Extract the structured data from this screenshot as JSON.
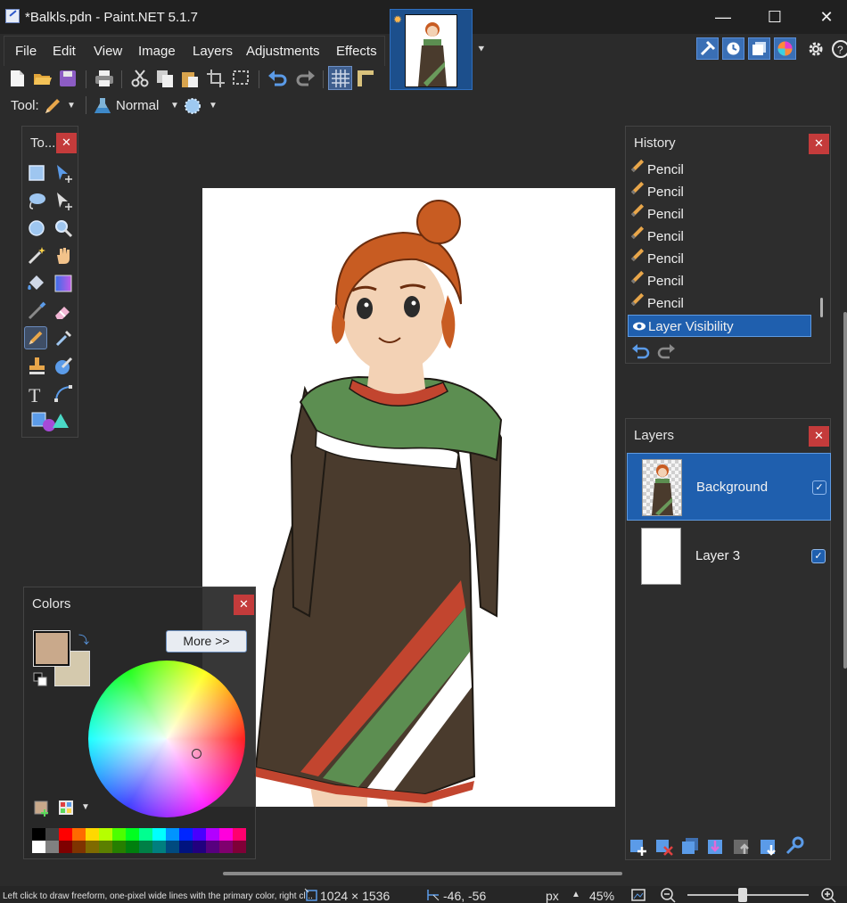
{
  "window": {
    "title": "*Balkls.pdn - Paint.NET 5.1.7",
    "minimize_glyph": "—",
    "maximize_glyph": "☐",
    "close_glyph": "✕"
  },
  "menu": {
    "items": [
      "File",
      "Edit",
      "View",
      "Image",
      "Layers",
      "Adjustments",
      "Effects"
    ]
  },
  "toolbar": {
    "tool_label": "Tool:",
    "blend_mode": "Normal",
    "icons": [
      "new-icon",
      "open-icon",
      "save-icon",
      "print-icon",
      "cut-icon",
      "copy-icon",
      "paste-icon",
      "crop-icon",
      "deselect-icon",
      "undo-icon",
      "redo-icon",
      "grid-icon",
      "ruler-icon"
    ]
  },
  "right_toolbar": {
    "icons": [
      "tools-window-icon",
      "history-window-icon",
      "layers-window-icon",
      "colors-window-icon",
      "settings-icon",
      "help-icon"
    ]
  },
  "tools_panel": {
    "title": "To...",
    "close": "✕"
  },
  "history": {
    "title": "History",
    "close": "✕",
    "items": [
      "Pencil",
      "Pencil",
      "Pencil",
      "Pencil",
      "Pencil",
      "Pencil",
      "Pencil",
      "Layer Visibility"
    ],
    "selected_index": 7
  },
  "layers": {
    "title": "Layers",
    "close": "✕",
    "items": [
      {
        "name": "Background",
        "visible": true,
        "selected": true
      },
      {
        "name": "Layer 3",
        "visible": true,
        "selected": false
      }
    ]
  },
  "colors": {
    "title": "Colors",
    "close": "✕",
    "more_button": "More >>",
    "primary": "#c9a98b",
    "secondary": "#d4c9ad"
  },
  "status": {
    "hint": "Left click to draw freeform, one-pixel wide lines with the primary color, right cl...",
    "image_size": "1024 × 1536",
    "cursor_position": "-46, -56",
    "unit": "px",
    "zoom": "45%"
  },
  "accent": "#1f5fae"
}
